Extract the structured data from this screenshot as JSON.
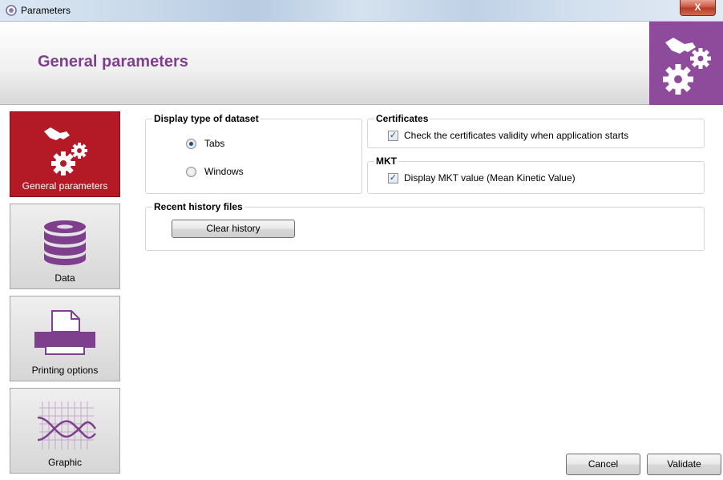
{
  "window": {
    "title": "Parameters",
    "close_label": "X"
  },
  "header": {
    "title": "General parameters"
  },
  "sidebar": {
    "items": [
      {
        "label": "General parameters",
        "icon": "gears-icon",
        "active": true
      },
      {
        "label": "Data",
        "icon": "database-icon",
        "active": false
      },
      {
        "label": "Printing options",
        "icon": "printer-icon",
        "active": false
      },
      {
        "label": "Graphic",
        "icon": "graph-icon",
        "active": false
      }
    ]
  },
  "display_type": {
    "legend": "Display type of dataset",
    "options": [
      {
        "label": "Tabs",
        "checked": true
      },
      {
        "label": "Windows",
        "checked": false
      }
    ]
  },
  "certificates": {
    "legend": "Certificates",
    "check_label": "Check the certificates validity when application starts",
    "checked": true
  },
  "mkt": {
    "legend": "MKT",
    "check_label": "Display MKT value (Mean Kinetic Value)",
    "checked": true
  },
  "history": {
    "legend": "Recent history files",
    "clear_label": "Clear history"
  },
  "footer": {
    "cancel_label": "Cancel",
    "validate_label": "Validate"
  },
  "colors": {
    "accent": "#7e3f8d",
    "logo_bg": "#8e4b9c",
    "active_nav": "#b31a25"
  }
}
